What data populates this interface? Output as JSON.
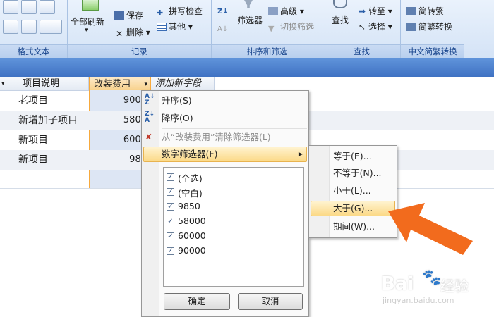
{
  "ribbon": {
    "groups": [
      {
        "label": "格式文本"
      },
      {
        "label": "记录"
      },
      {
        "label": "排序和筛选"
      },
      {
        "label": "查找"
      },
      {
        "label": "中文简繁转换"
      }
    ],
    "buttons": {
      "refresh_all": "全部刷新",
      "save": "保存",
      "delete": "删除",
      "spell_check": "拼写检查",
      "other": "其他",
      "filter": "筛选器",
      "advanced": "高级",
      "toggle_filter": "切换筛选",
      "find": "查找",
      "goto": "转至",
      "select": "选择",
      "to_simplified": "简转繁",
      "to_traditional": "简繁转换"
    }
  },
  "table": {
    "headers": [
      "项目说明",
      "改装费用",
      "添加新字段"
    ],
    "rows": [
      {
        "desc": "老项目",
        "cost": "9000"
      },
      {
        "desc": "新增加子项目",
        "cost": "5800"
      },
      {
        "desc": "新项目",
        "cost": "6000"
      },
      {
        "desc": "新项目",
        "cost": "985"
      }
    ]
  },
  "menu": {
    "sort_asc": "升序(S)",
    "sort_desc": "降序(O)",
    "clear_filter": "从“改装费用”清除筛选器(L)",
    "number_filters": "数字筛选器(F)",
    "checklist": [
      "(全选)",
      "(空白)",
      "9850",
      "58000",
      "60000",
      "90000"
    ],
    "ok": "确定",
    "cancel": "取消"
  },
  "submenu": {
    "items": [
      "等于(E)...",
      "不等于(N)...",
      "小于(L)...",
      "大于(G)...",
      "期间(W)..."
    ],
    "highlighted_index": 3
  },
  "watermark": {
    "brand": "Bai",
    "brand2": "经验",
    "url": "jingyan.baidu.com"
  },
  "colors": {
    "accent": "#f7a93c",
    "arrow": "#f26b1d",
    "ribbon_text": "#15428b"
  }
}
